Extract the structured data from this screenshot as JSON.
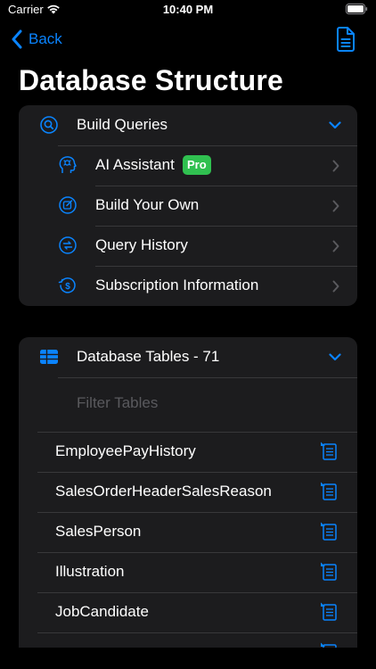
{
  "status_bar": {
    "carrier": "Carrier",
    "time": "10:40 PM",
    "icons": [
      "wifi-icon",
      "battery-icon"
    ]
  },
  "nav": {
    "back_label": "Back",
    "right_icon": "document-icon"
  },
  "title": "Database Structure",
  "accent_color": "#0a84ff",
  "queries_section": {
    "header": "Build Queries",
    "header_icon": "search-circle-icon",
    "items": [
      {
        "label": "AI Assistant",
        "icon": "ai-brain-icon",
        "badge": "Pro"
      },
      {
        "label": "Build Your Own",
        "icon": "edit-square-icon"
      },
      {
        "label": "Query History",
        "icon": "history-icon"
      },
      {
        "label": "Subscription Information",
        "icon": "dollar-refresh-icon"
      }
    ]
  },
  "tables_section": {
    "header": "Database Tables - 71",
    "header_icon": "table-grid-icon",
    "filter_placeholder": "Filter Tables",
    "items": [
      {
        "label": "EmployeePayHistory"
      },
      {
        "label": "SalesOrderHeaderSalesReason"
      },
      {
        "label": "SalesPerson"
      },
      {
        "label": "Illustration"
      },
      {
        "label": "JobCandidate"
      }
    ]
  },
  "pro_badge_color": "#30c050"
}
